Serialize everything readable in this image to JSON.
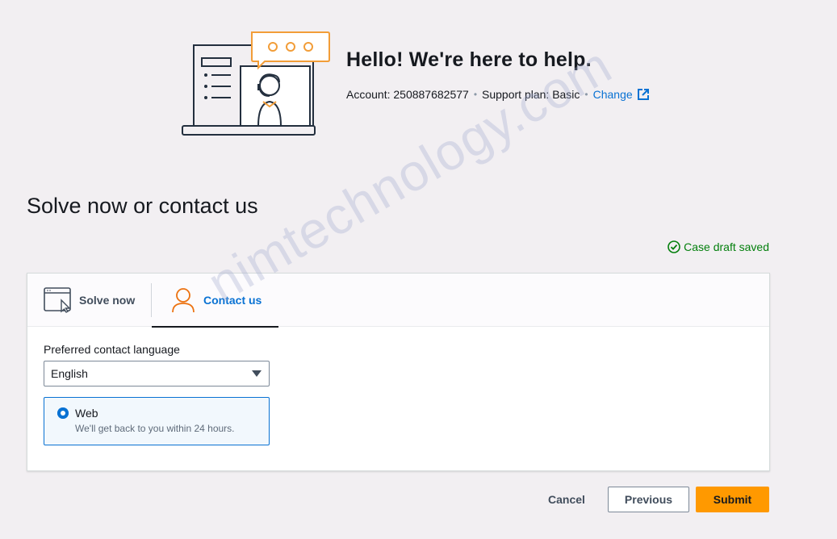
{
  "hero": {
    "title": "Hello!  We're here to help.",
    "account_label": "Account: 250887682577",
    "plan_label": "Support plan: Basic",
    "separator": "•",
    "change_link": "Change",
    "illustration": "support-agent-illustration"
  },
  "section": {
    "title": "Solve now or contact us",
    "draft_status": "Case draft saved"
  },
  "tabs": [
    {
      "label": "Solve now",
      "icon": "browser-cursor-icon",
      "selected": false
    },
    {
      "label": "Contact us",
      "icon": "person-icon",
      "selected": true
    }
  ],
  "form": {
    "language_label": "Preferred contact language",
    "language_value": "English",
    "contact_option": {
      "title": "Web",
      "description": "We'll get back to you within 24 hours.",
      "selected": true
    }
  },
  "actions": {
    "cancel": "Cancel",
    "previous": "Previous",
    "submit": "Submit"
  },
  "watermark": "nimtechnology.com",
  "colors": {
    "accent": "#0972d3",
    "primary_button": "#ff9900",
    "success": "#037f0c",
    "illustration_orange": "#f29d38"
  }
}
